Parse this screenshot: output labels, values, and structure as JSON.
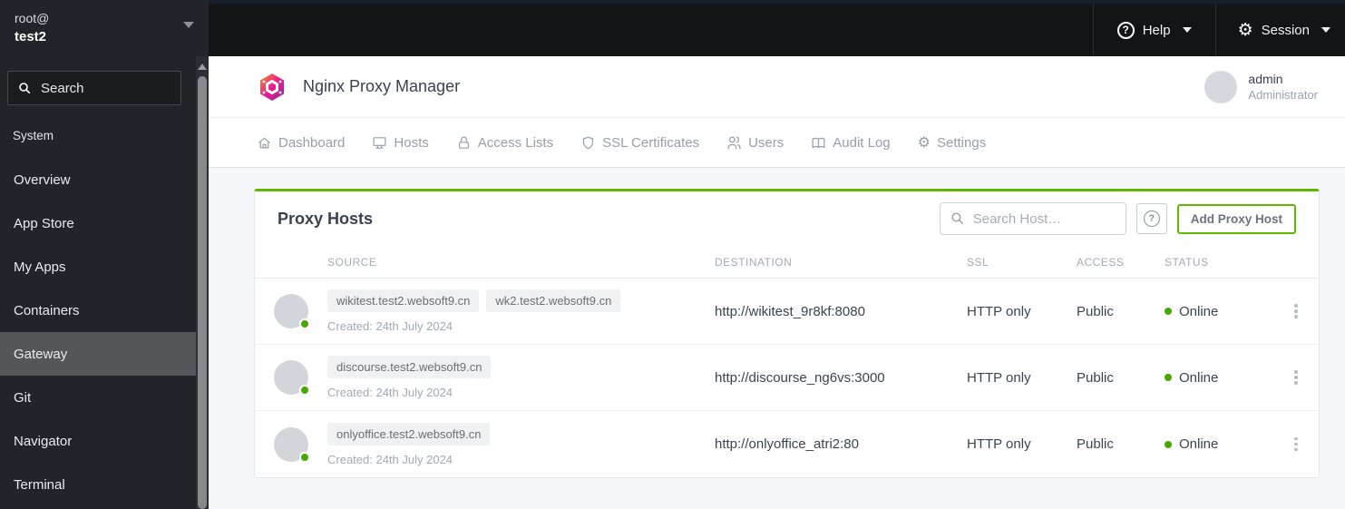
{
  "colors": {
    "accent_green": "#5eba00",
    "status_green": "#46a800",
    "sidebar_bg": "#212529",
    "topbar_bg": "#131416",
    "main_bg": "#f5f7fb"
  },
  "icons": {
    "question_mark": "?",
    "gear": "⚙"
  },
  "sidebar": {
    "user_line1": "root@",
    "user_line2": "test2",
    "search_placeholder": "Search",
    "section_label": "System",
    "items": [
      {
        "label": "Overview"
      },
      {
        "label": "App Store"
      },
      {
        "label": "My Apps"
      },
      {
        "label": "Containers"
      },
      {
        "label": "Gateway"
      },
      {
        "label": "Git"
      },
      {
        "label": "Navigator"
      },
      {
        "label": "Terminal"
      }
    ]
  },
  "topbar": {
    "help_label": "Help",
    "session_label": "Session"
  },
  "header": {
    "app_title": "Nginx Proxy Manager",
    "user_name": "admin",
    "user_role": "Administrator"
  },
  "tabs": [
    {
      "label": "Dashboard"
    },
    {
      "label": "Hosts"
    },
    {
      "label": "Access Lists"
    },
    {
      "label": "SSL Certificates"
    },
    {
      "label": "Users"
    },
    {
      "label": "Audit Log"
    },
    {
      "label": "Settings"
    }
  ],
  "card": {
    "title": "Proxy Hosts",
    "search_placeholder": "Search Host…",
    "add_button_label": "Add Proxy Host",
    "table": {
      "headers": [
        "SOURCE",
        "DESTINATION",
        "SSL",
        "ACCESS",
        "STATUS"
      ],
      "rows": [
        {
          "sources": [
            "wikitest.test2.websoft9.cn",
            "wk2.test2.websoft9.cn"
          ],
          "created": "Created: 24th July 2024",
          "destination": "http://wikitest_9r8kf:8080",
          "ssl": "HTTP only",
          "access": "Public",
          "status": "Online"
        },
        {
          "sources": [
            "discourse.test2.websoft9.cn"
          ],
          "created": "Created: 24th July 2024",
          "destination": "http://discourse_ng6vs:3000",
          "ssl": "HTTP only",
          "access": "Public",
          "status": "Online"
        },
        {
          "sources": [
            "onlyoffice.test2.websoft9.cn"
          ],
          "created": "Created: 24th July 2024",
          "destination": "http://onlyoffice_atri2:80",
          "ssl": "HTTP only",
          "access": "Public",
          "status": "Online"
        }
      ]
    }
  }
}
